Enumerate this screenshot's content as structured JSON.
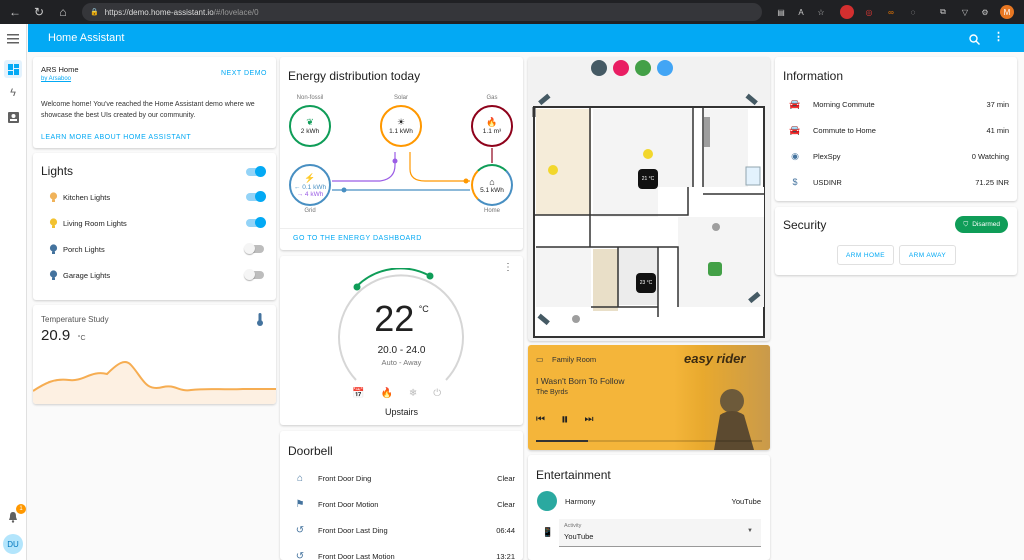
{
  "browser": {
    "url_host": "https://demo.home-assistant.io",
    "url_path": "/#/lovelace/0"
  },
  "app": {
    "title": "Home Assistant"
  },
  "sidebar": {
    "user_initials": "DU",
    "notification_count": "1"
  },
  "welcome": {
    "title": "ARS Home",
    "byline": "by Arsaboo",
    "next_demo": "NEXT DEMO",
    "text": "Welcome home! You've reached the Home Assistant demo where we showcase the best UIs created by our community.",
    "learn_more": "LEARN MORE ABOUT HOME ASSISTANT"
  },
  "lights": {
    "title": "Lights",
    "items": [
      {
        "label": "Kitchen Lights",
        "on": true,
        "color": "#f0b35a"
      },
      {
        "label": "Living Room Lights",
        "on": true,
        "color": "#f2c230"
      },
      {
        "label": "Porch Lights",
        "on": false,
        "color": "#44739e"
      },
      {
        "label": "Garage Lights",
        "on": false,
        "color": "#44739e"
      }
    ]
  },
  "temperature": {
    "title": "Temperature Study",
    "value": "20.9",
    "unit": "°C"
  },
  "energy": {
    "title": "Energy distribution today",
    "nonfossil_label": "Non-fossil",
    "nonfossil_value": "2 kWh",
    "solar_label": "Solar",
    "solar_value": "1.1 kWh",
    "gas_label": "Gas",
    "gas_value": "1.1 m³",
    "grid_label": "Grid",
    "grid_in": "← 0.1 kWh",
    "grid_out": "→ 4 kWh",
    "home_label": "Home",
    "home_value": "5.1 kWh",
    "link": "GO TO THE ENERGY DASHBOARD"
  },
  "thermostat": {
    "value": "22",
    "unit": "°C",
    "range": "20.0 - 24.0",
    "mode": "Auto - Away",
    "name": "Upstairs"
  },
  "doorbell": {
    "title": "Doorbell",
    "items": [
      {
        "label": "Front Door Ding",
        "value": "Clear"
      },
      {
        "label": "Front Door Motion",
        "value": "Clear"
      },
      {
        "label": "Front Door Last Ding",
        "value": "06:44"
      },
      {
        "label": "Front Door Last Motion",
        "value": "13:21"
      }
    ]
  },
  "floorplan": {
    "temp1": "21 °C",
    "temp2": "23 °C"
  },
  "media": {
    "room": "Family Room",
    "title": "I Wasn't Born To Follow",
    "artist": "The Byrds",
    "album_text": "easy rider",
    "progress": 0.23
  },
  "entertainment": {
    "title": "Entertainment",
    "harmony_label": "Harmony",
    "harmony_value": "YouTube",
    "activity_label": "Activity",
    "activity_value": "YouTube"
  },
  "information": {
    "title": "Information",
    "items": [
      {
        "label": "Morning Commute",
        "value": "37 min"
      },
      {
        "label": "Commute to Home",
        "value": "41 min"
      },
      {
        "label": "PlexSpy",
        "value": "0 Watching"
      },
      {
        "label": "USDINR",
        "value": "71.25 INR"
      }
    ]
  },
  "security": {
    "title": "Security",
    "badge": "Disarmed",
    "arm_home": "ARM HOME",
    "arm_away": "ARM AWAY"
  }
}
